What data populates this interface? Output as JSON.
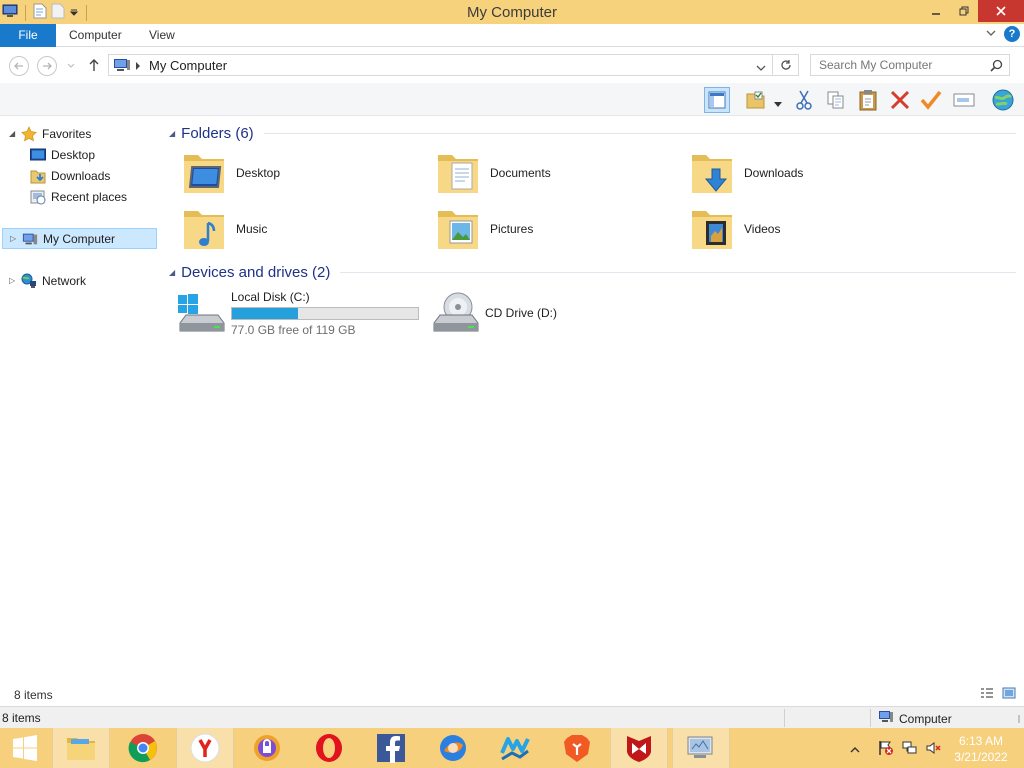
{
  "window": {
    "title": "My Computer"
  },
  "ribbon": {
    "file": "File",
    "tabs": [
      "Computer",
      "View"
    ]
  },
  "address": {
    "path": "My Computer"
  },
  "search": {
    "placeholder": "Search My Computer"
  },
  "nav": {
    "favorites": {
      "label": "Favorites",
      "items": [
        "Desktop",
        "Downloads",
        "Recent places"
      ]
    },
    "computer": "My Computer",
    "network": "Network"
  },
  "content": {
    "folders_header": "Folders (6)",
    "folders": [
      "Desktop",
      "Documents",
      "Downloads",
      "Music",
      "Pictures",
      "Videos"
    ],
    "drives_header": "Devices and drives (2)",
    "drives": [
      {
        "name": "Local Disk (C:)",
        "free": "77.0 GB free of 119 GB",
        "used_fraction": 0.353
      },
      {
        "name": "CD Drive (D:)"
      }
    ]
  },
  "status": {
    "items": "8 items"
  },
  "details": {
    "items": "8 items",
    "location": "Computer"
  },
  "clock": {
    "time": "6:13 AM",
    "date": "3/21/2022"
  },
  "colors": {
    "accent": "#1979ca",
    "taskbar": "#f6d07d",
    "titlebar": "#f7d27d",
    "header_text": "#1e3287",
    "drive_bar": "#26a0da"
  },
  "icons": {
    "taskbar": [
      "file-explorer-icon",
      "chrome-icon",
      "yandex-icon",
      "vpn-icon",
      "opera-icon",
      "facebook-icon",
      "browser-icon",
      "wave-browser-icon",
      "brave-icon",
      "mcafee-icon",
      "my-computer-icon"
    ]
  }
}
